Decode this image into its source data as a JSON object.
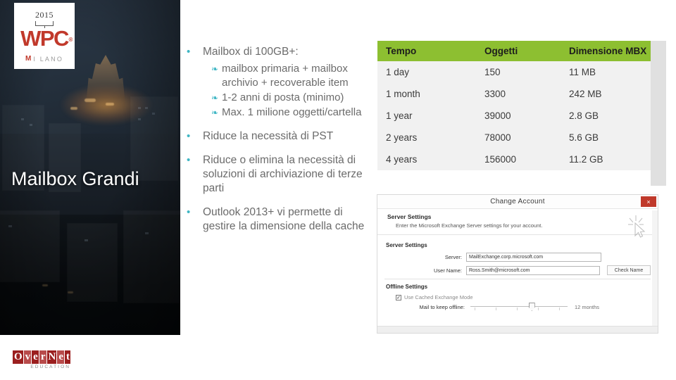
{
  "brand": {
    "year": "2015",
    "name": "WPC",
    "city": "I LANO",
    "city_mark": "M"
  },
  "slide": {
    "title": "Mailbox Grandi"
  },
  "footer_logo": {
    "cells": [
      "O",
      "v",
      "e",
      "r",
      "N",
      "e",
      "t"
    ],
    "subtitle": "EDUCATION"
  },
  "bullets": {
    "items": [
      {
        "marker": "•",
        "text": "Mailbox di 100GB+:",
        "subitems": [
          {
            "marker": "❧",
            "text": "mailbox primaria + mailbox archivio + recoverable item"
          },
          {
            "marker": "❧",
            "text": "1-2 anni di posta (minimo)"
          },
          {
            "marker": "❧",
            "text": "Max. 1 milione oggetti/cartella"
          }
        ]
      },
      {
        "marker": "•",
        "text": "Riduce la necessità di PST",
        "subitems": []
      },
      {
        "marker": "•",
        "text": "Riduce o elimina la necessità di soluzioni di archiviazione di terze parti",
        "subitems": []
      },
      {
        "marker": "•",
        "text": "Outlook 2013+ vi permette di gestire la dimensione della cache",
        "subitems": []
      }
    ]
  },
  "table": {
    "headers": [
      "Tempo",
      "Oggetti",
      "Dimensione MBX"
    ],
    "rows": [
      [
        "1 day",
        "150",
        "11 MB"
      ],
      [
        "1 month",
        "3300",
        "242 MB"
      ],
      [
        "1 year",
        "39000",
        "2.8 GB"
      ],
      [
        "2 years",
        "78000",
        "5.6 GB"
      ],
      [
        "4 years",
        "156000",
        "11.2 GB"
      ]
    ],
    "header_bg": "#8dbf31",
    "row_bg": "#f1f1f1"
  },
  "dialog": {
    "title": "Change Account",
    "close_label": "×",
    "header_title": "Server Settings",
    "header_subtitle": "Enter the Microsoft Exchange Server settings for your account.",
    "group_label": "Server Settings",
    "fields": [
      {
        "label": "Server:",
        "value": "MailExchange.corp.microsoft.com",
        "button": ""
      },
      {
        "label": "User Name:",
        "value": "Ross.Smith@microsoft.com",
        "button": "Check Name"
      }
    ],
    "offline_label": "Offline Settings",
    "cached_checkbox_label": "Use Cached Exchange Mode",
    "cached_checkbox_checked": "✓",
    "slider_label": "Mail to keep offline:",
    "slider_value": "12 months"
  },
  "colors": {
    "accent_teal": "#3fb6c4",
    "brand_red": "#c1392b",
    "table_green": "#8dbf31",
    "logo_dark_red": "#9b1f1f"
  }
}
